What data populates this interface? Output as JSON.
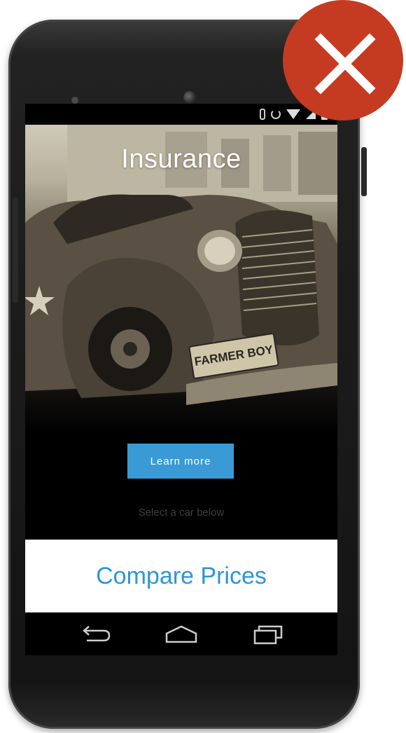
{
  "screen": {
    "hero_title": "Insurance",
    "learn_more_label": "Learn more",
    "select_hint": "Select a car below",
    "compare_label": "Compare Prices",
    "license_plate": "FARMER BOY"
  },
  "status_icons": [
    "bluetooth-icon",
    "rotation-icon",
    "wifi-icon",
    "signal-icon",
    "battery-icon"
  ],
  "nav_icons": [
    "back-icon",
    "home-icon",
    "recents-icon"
  ],
  "badge": {
    "icon": "close-icon",
    "color": "#c43b22"
  },
  "colors": {
    "accent": "#3a9ad6",
    "compare_text": "#2e96d6"
  }
}
